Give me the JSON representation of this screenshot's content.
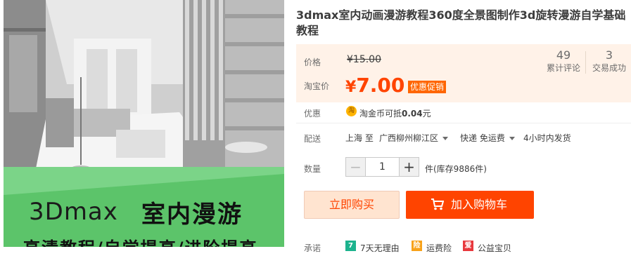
{
  "product": {
    "title": "3dmax室内动画漫游教程360度全景图制作3d旋转漫游自学基础教程",
    "image": {
      "banner_line1": "3Dmax",
      "banner_line1_b": "室内漫游",
      "banner_line2": "高清教程/自学提高/进阶提高"
    }
  },
  "price_box": {
    "price_label": "价格",
    "original_price": "¥15.00",
    "taobao_label": "淘宝价",
    "current_yen": "¥",
    "current_price": "7.00",
    "promo_tag": "优惠促销",
    "stats": [
      {
        "value": "49",
        "label": "累计评论"
      },
      {
        "value": "3",
        "label": "交易成功"
      }
    ]
  },
  "promo_row": {
    "label": "优惠",
    "coin_icon": "淘",
    "text_prefix": "淘金币可抵",
    "text_amount": "0.04",
    "text_suffix": "元"
  },
  "shipping_row": {
    "label": "配送",
    "from": "上海 至",
    "to": "广西柳州柳江区",
    "method": "快递 免运费",
    "eta": "4小时内发货"
  },
  "quantity_row": {
    "label": "数量",
    "minus": "−",
    "value": "1",
    "plus": "+",
    "stock": "件(库存9886件)"
  },
  "actions": {
    "buy_now": "立即购买",
    "add_to_cart": "加入购物车"
  },
  "promise_row": {
    "label": "承诺",
    "items": [
      "7天无理由",
      "运费险",
      "公益宝贝"
    ],
    "icons": [
      "7",
      "险",
      "爱"
    ]
  },
  "colors": {
    "accent": "#ff4400",
    "price_bg": "#fff2e8",
    "promo_tag": "#ff6600"
  }
}
